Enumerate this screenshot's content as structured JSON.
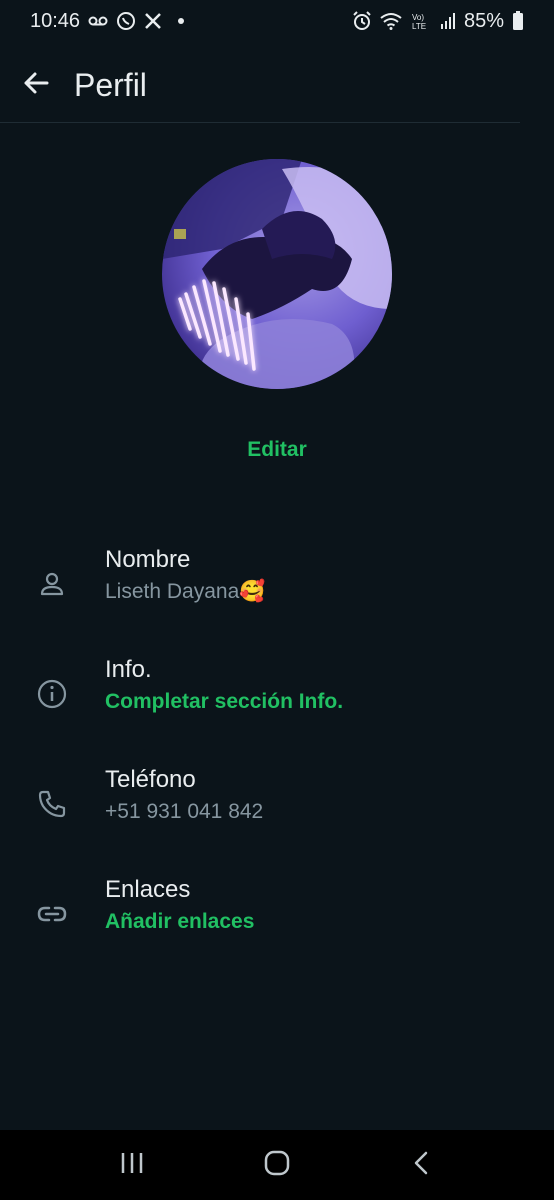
{
  "status_bar": {
    "time": "10:46",
    "battery": "85%",
    "left_icons": [
      "voicemail-icon",
      "whatsapp-icon",
      "x-icon",
      "notification-dot"
    ],
    "right_icons": [
      "alarm-icon",
      "wifi-icon",
      "volte-icon",
      "signal-icon",
      "battery-icon"
    ]
  },
  "header": {
    "title": "Perfil",
    "back_icon": "arrow-left-icon"
  },
  "profile": {
    "edit_label": "Editar"
  },
  "rows": [
    {
      "label": "Nombre",
      "value": "Liseth Dayana🥰",
      "icon": "person-icon",
      "value_style": "muted"
    },
    {
      "label": "Info.",
      "value": "Completar sección Info.",
      "icon": "info-icon",
      "value_style": "accent"
    },
    {
      "label": "Teléfono",
      "value": "+51 931 041 842",
      "icon": "phone-icon",
      "value_style": "muted"
    },
    {
      "label": "Enlaces",
      "value": "Añadir enlaces",
      "icon": "link-icon",
      "value_style": "accent"
    }
  ],
  "nav_bar": {
    "icons": [
      "recent-apps-icon",
      "home-icon",
      "back-icon"
    ]
  },
  "colors": {
    "background": "#0b141a",
    "accent": "#21c063",
    "text_primary": "#e9edef",
    "text_secondary": "#8696a0"
  }
}
